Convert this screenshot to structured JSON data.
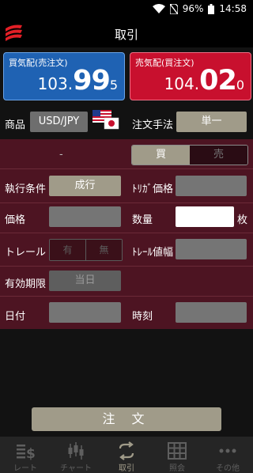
{
  "status": {
    "battery": "96%",
    "time": "14:58"
  },
  "header": {
    "title": "取引"
  },
  "prices": {
    "buy": {
      "label": "買気配(売注文)",
      "main": "103.",
      "big": "99",
      "small": "5"
    },
    "sell": {
      "label": "売気配(買注文)",
      "main": "104.",
      "big": "02",
      "small": "0"
    }
  },
  "product": {
    "label": "商品",
    "value": "USD/JPY",
    "method_label": "注文手法",
    "method_value": "単一"
  },
  "form": {
    "dash": "-",
    "side": {
      "buy": "買",
      "sell": "売",
      "selected": "buy"
    },
    "condition_label": "執行条件",
    "condition_value": "成行",
    "trigger_label": "ﾄﾘｶﾞ価格",
    "price_label": "価格",
    "qty_label": "数量",
    "qty_unit": "枚",
    "trail_label": "トレール",
    "trail_on": "有",
    "trail_off": "無",
    "trail_width_label": "ﾄﾚｰﾙ値幅",
    "expiry_label": "有効期限",
    "expiry_value": "当日",
    "date_label": "日付",
    "time_label": "時刻"
  },
  "order_button": "注 文",
  "nav": [
    {
      "label": "レート",
      "icon": "dollar-icon"
    },
    {
      "label": "チャート",
      "icon": "candlestick-icon"
    },
    {
      "label": "取引",
      "icon": "exchange-icon",
      "active": true
    },
    {
      "label": "照会",
      "icon": "grid-icon"
    },
    {
      "label": "その他",
      "icon": "more-icon"
    }
  ],
  "colors": {
    "buy": "#1f62b3",
    "sell": "#c8102e",
    "accent": "#a09b89",
    "form_bg": "#4d1422"
  }
}
